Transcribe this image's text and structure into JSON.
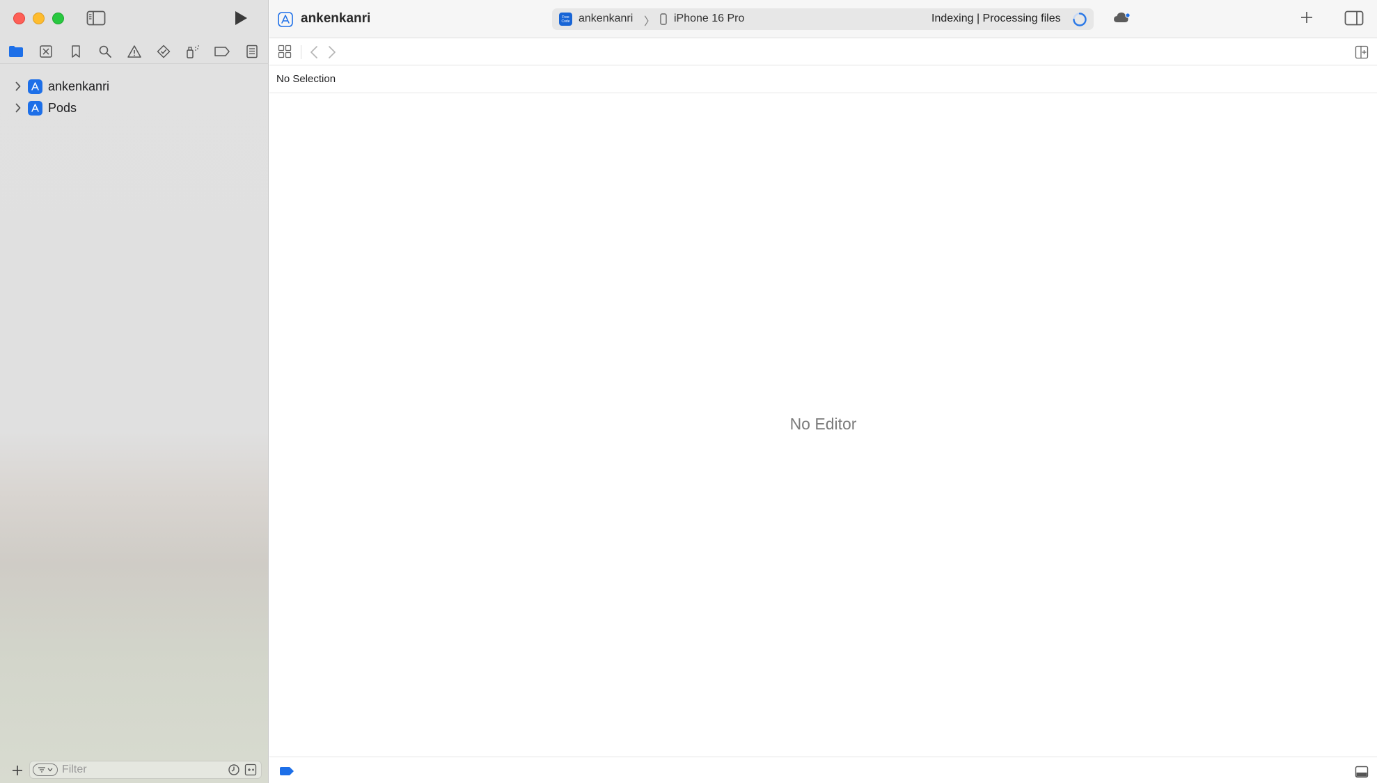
{
  "window": {
    "project_title": "ankenkanri"
  },
  "toolbar": {
    "scheme": "ankenkanri",
    "scheme_separator": "〉",
    "destination": "iPhone 16 Pro",
    "activity_status": "Indexing | Processing files",
    "scheme_icon_text": "Free Code",
    "icons": {
      "run": "play-icon",
      "navigator_toggle": "sidebar-left-icon",
      "cloud": "cloud-icon",
      "add": "plus-icon",
      "inspector_toggle": "sidebar-right-icon"
    }
  },
  "navigator": {
    "tabs": [
      {
        "name": "project-navigator",
        "icon": "folder-icon",
        "selected": true
      },
      {
        "name": "source-control-navigator",
        "icon": "source-control-icon"
      },
      {
        "name": "bookmark-navigator",
        "icon": "bookmark-icon"
      },
      {
        "name": "find-navigator",
        "icon": "search-icon"
      },
      {
        "name": "issue-navigator",
        "icon": "warning-icon"
      },
      {
        "name": "test-navigator",
        "icon": "test-diamond-icon"
      },
      {
        "name": "debug-navigator",
        "icon": "spray-can-icon"
      },
      {
        "name": "breakpoint-navigator",
        "icon": "breakpoint-tag-icon"
      },
      {
        "name": "report-navigator",
        "icon": "report-list-icon"
      }
    ],
    "items": [
      {
        "label": "ankenkanri",
        "expanded": false
      },
      {
        "label": "Pods",
        "expanded": false
      }
    ],
    "filter_placeholder": "Filter"
  },
  "editor": {
    "selection_label": "No Selection",
    "placeholder": "No Editor"
  },
  "colors": {
    "accent": "#1d6fe8",
    "close": "#fe5f57",
    "minimize": "#febc2e",
    "maximize": "#28c840"
  }
}
